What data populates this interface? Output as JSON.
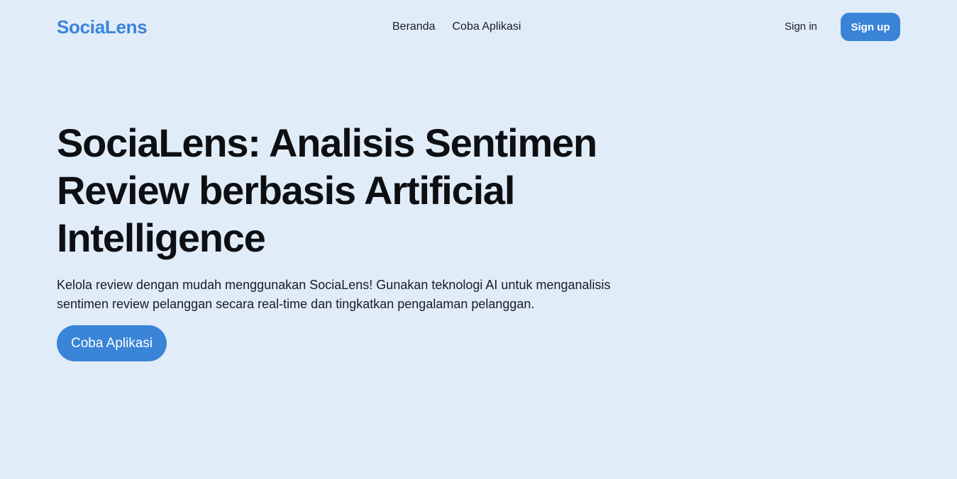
{
  "header": {
    "brand": "SociaLens",
    "nav": [
      {
        "label": "Beranda"
      },
      {
        "label": "Coba Aplikasi"
      }
    ],
    "sign_in_label": "Sign in",
    "sign_up_label": "Sign up"
  },
  "hero": {
    "title": "SociaLens: Analisis Sentimen Review berbasis Artificial Intelligence",
    "description": "Kelola review dengan mudah menggunakan SociaLens! Gunakan teknologi AI untuk menganalisis sentimen review pelanggan secara real-time dan tingkatkan pengalaman pelanggan.",
    "cta_label": "Coba Aplikasi"
  },
  "colors": {
    "background": "#e0ecf8",
    "accent": "#3a84d8",
    "text": "#111418"
  }
}
